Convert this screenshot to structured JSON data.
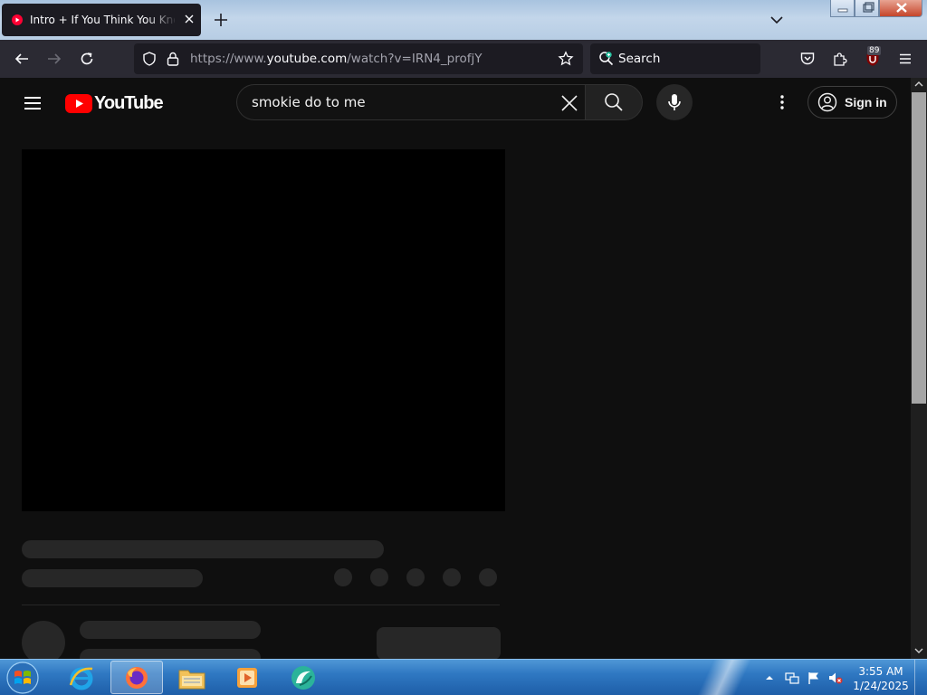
{
  "browser": {
    "tab": {
      "title": "Intro + If You Think You Know How to Love Me",
      "favicon": "youtube-icon"
    },
    "new_tab": "plus-icon",
    "url": {
      "scheme_prefix": "https://www.",
      "domain": "youtube.com",
      "path": "/watch?v=IRN4_profjY"
    },
    "search_placeholder": "Search",
    "extension_badge": "89",
    "colors": {
      "toolbar": "#2b2a33",
      "field": "#1c1b22",
      "accent": "#e22850"
    }
  },
  "youtube": {
    "logo_text": "YouTube",
    "search_query": "smokie do to me",
    "sign_in_label": "Sign in",
    "colors": {
      "background": "#0f0f0f",
      "brand_red": "#ff0000",
      "skeleton": "#272727"
    }
  },
  "taskbar": {
    "pinned": [
      "internet-explorer-icon",
      "firefox-icon",
      "file-explorer-icon",
      "media-player-icon",
      "app-icon"
    ],
    "active": "firefox-icon",
    "clock": {
      "time": "3:55 AM",
      "date": "1/24/2025"
    }
  }
}
